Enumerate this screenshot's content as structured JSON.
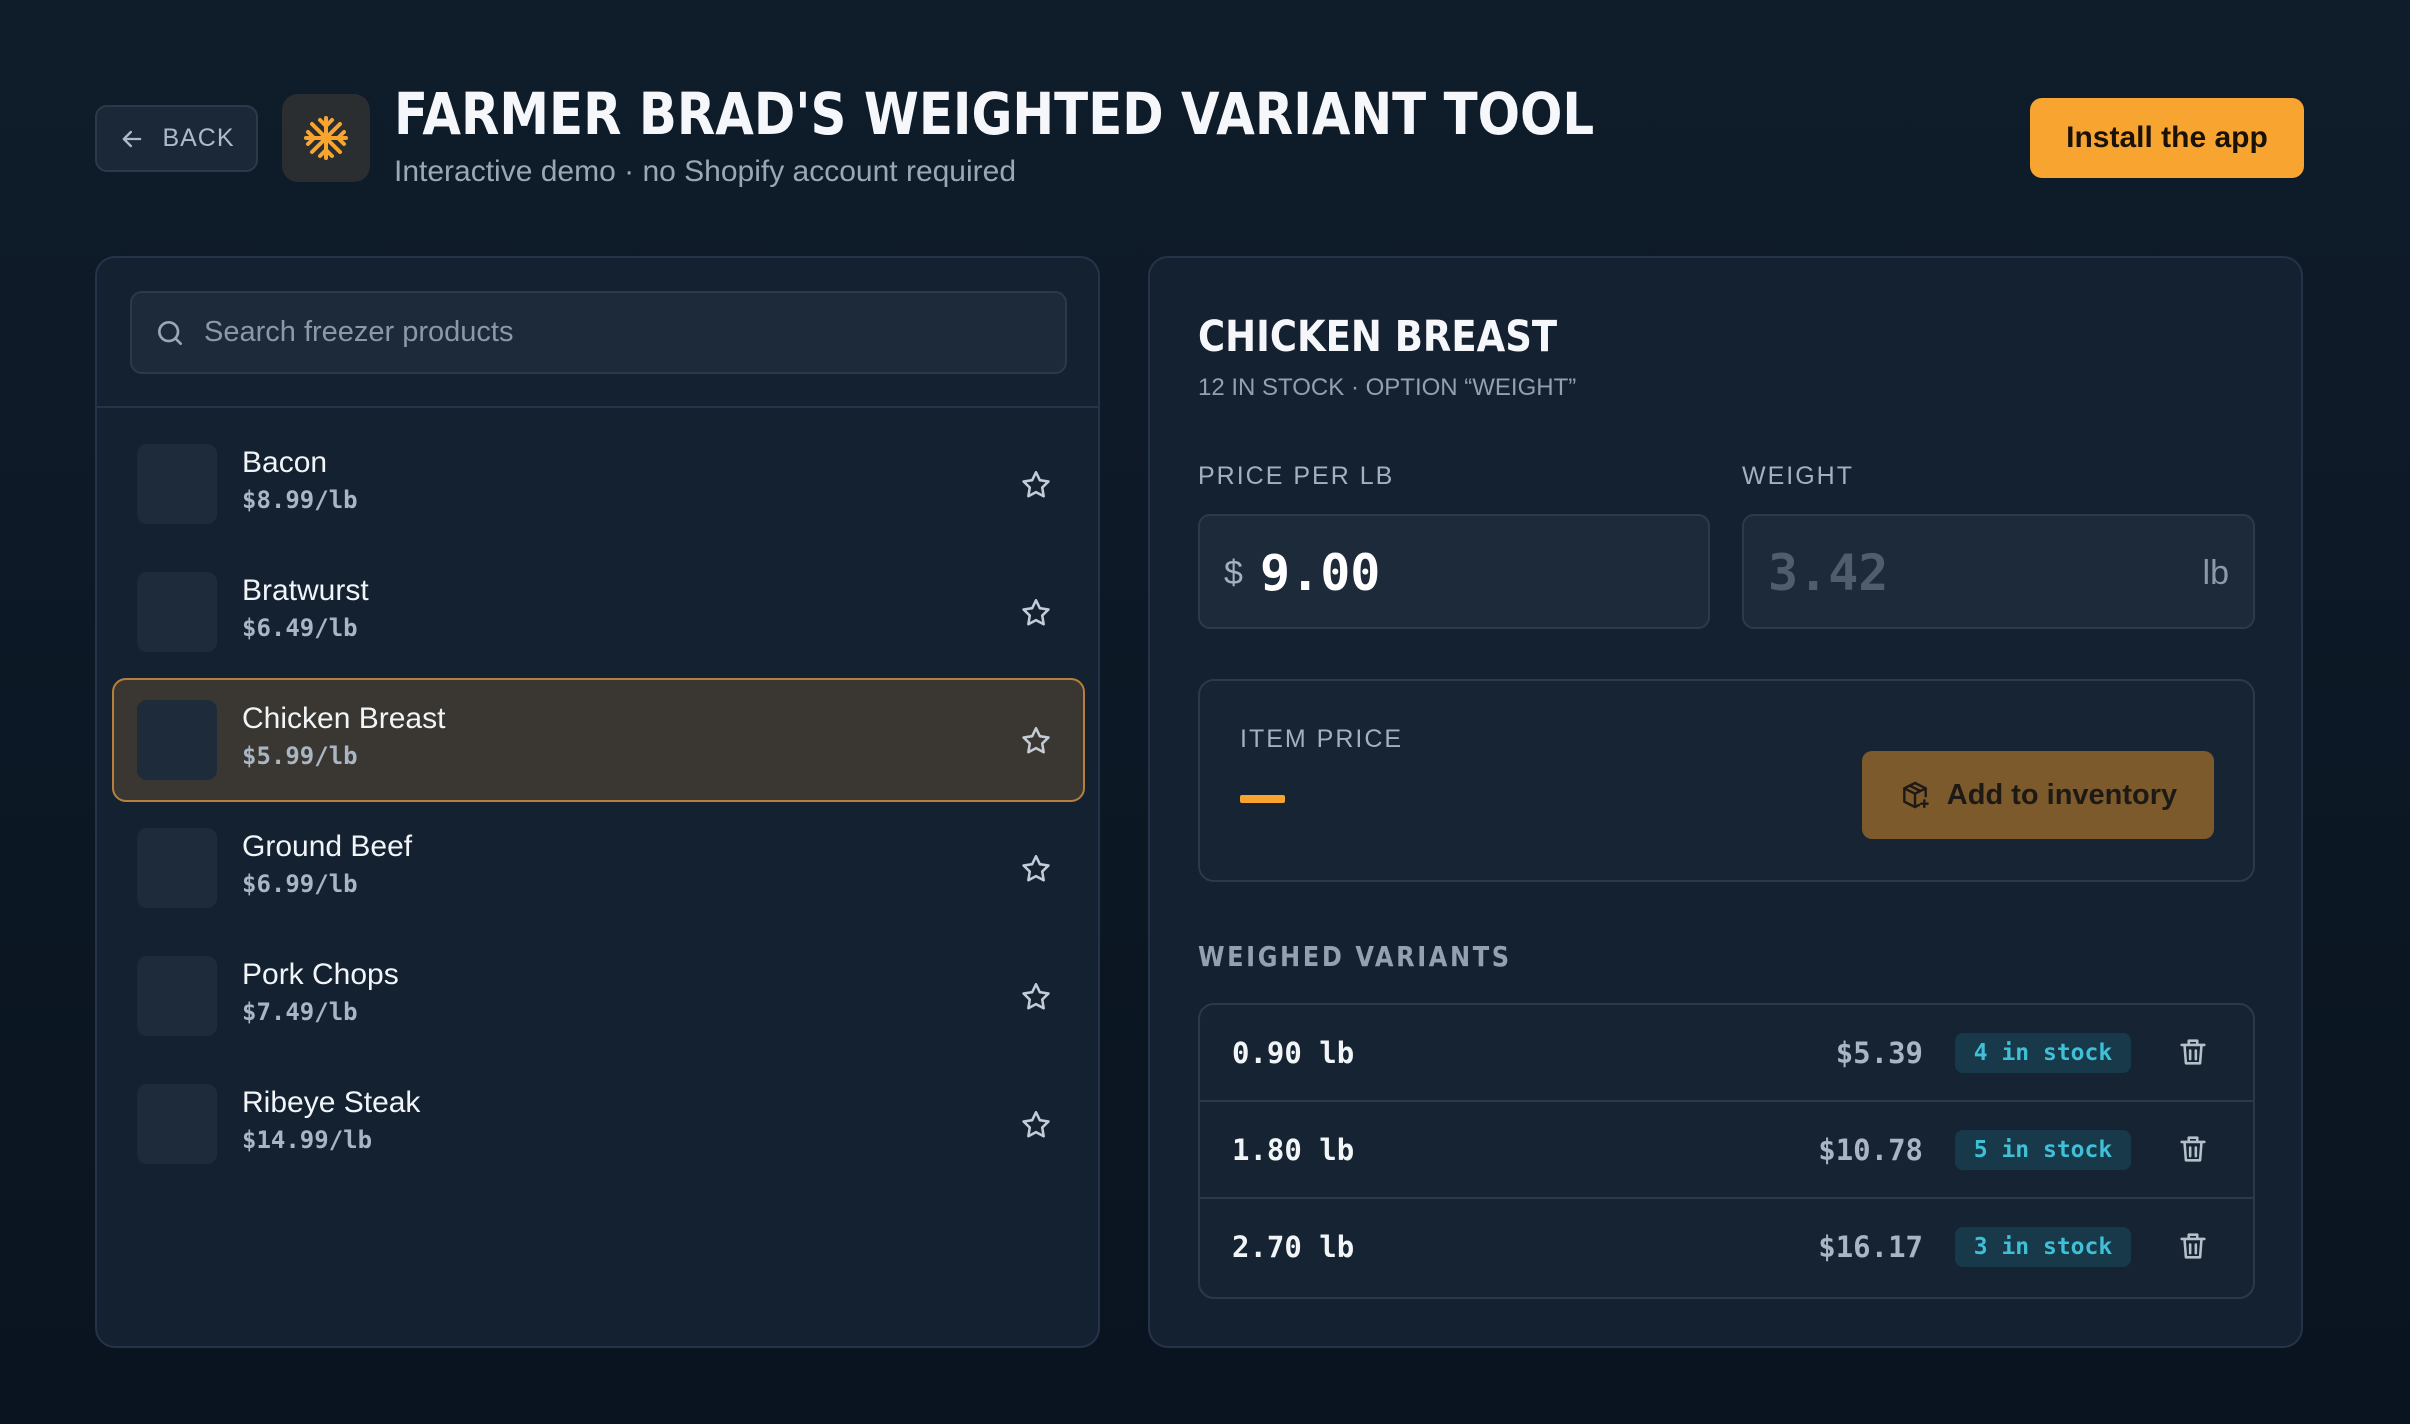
{
  "header": {
    "back_label": "BACK",
    "title": "FARMER BRAD'S WEIGHTED VARIANT TOOL",
    "subtitle": "Interactive demo · no Shopify account required",
    "install_label": "Install the app",
    "logo_icon": "snowflake-icon"
  },
  "search": {
    "placeholder": "Search freezer products",
    "value": ""
  },
  "products": [
    {
      "name": "Bacon",
      "price": "$8.99/lb",
      "selected": false
    },
    {
      "name": "Bratwurst",
      "price": "$6.49/lb",
      "selected": false
    },
    {
      "name": "Chicken Breast",
      "price": "$5.99/lb",
      "selected": true
    },
    {
      "name": "Ground Beef",
      "price": "$6.99/lb",
      "selected": false
    },
    {
      "name": "Pork Chops",
      "price": "$7.49/lb",
      "selected": false
    },
    {
      "name": "Ribeye Steak",
      "price": "$14.99/lb",
      "selected": false
    }
  ],
  "detail": {
    "title": "CHICKEN BREAST",
    "meta": "12 IN STOCK · OPTION “WEIGHT”",
    "price_label": "PRICE PER LB",
    "currency": "$",
    "price_value": "9.00",
    "weight_label": "WEIGHT",
    "weight_placeholder": "3.42",
    "weight_unit": "lb",
    "item_price_label": "ITEM PRICE",
    "add_label": "Add to inventory",
    "variants_title": "WEIGHED VARIANTS"
  },
  "variants": [
    {
      "weight": "0.90 lb",
      "price": "$5.39",
      "stock": "4 in stock"
    },
    {
      "weight": "1.80 lb",
      "price": "$10.78",
      "stock": "5 in stock"
    },
    {
      "weight": "2.70 lb",
      "price": "$16.17",
      "stock": "3 in stock"
    }
  ],
  "colors": {
    "accent": "#f7a530",
    "background": "#0f1c2a",
    "panel": "#142131",
    "badge_text": "#3fc0d6",
    "selected_border": "#b7803a"
  }
}
